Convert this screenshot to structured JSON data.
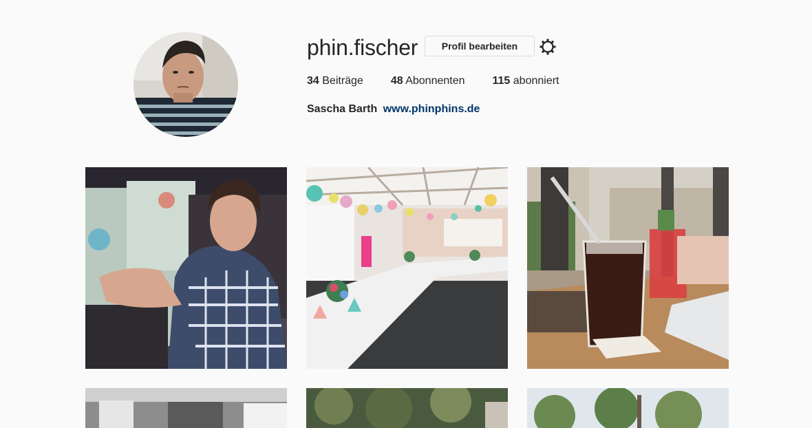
{
  "profile": {
    "username": "phin.fischer",
    "edit_button": "Profil bearbeiten",
    "settings_icon": "gear-icon",
    "stats": {
      "posts_count": "34",
      "posts_label": "Beiträge",
      "followers_count": "48",
      "followers_label": "Abonnenten",
      "following_count": "115",
      "following_label": "abonniert"
    },
    "bio": {
      "full_name": "Sascha Barth",
      "website": "www.phinphins.de"
    }
  },
  "posts": [
    {
      "index": 1
    },
    {
      "index": 2
    },
    {
      "index": 3
    },
    {
      "index": 4
    },
    {
      "index": 5
    },
    {
      "index": 6
    }
  ],
  "colors": {
    "background": "#fafafa",
    "text": "#262626",
    "link": "#003569",
    "border": "#dbdbdb"
  }
}
